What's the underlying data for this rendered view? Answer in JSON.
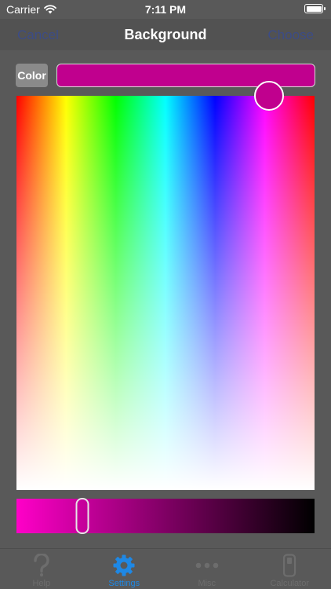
{
  "status_bar": {
    "carrier": "Carrier",
    "time": "7:11 PM"
  },
  "nav": {
    "cancel_label": "Cancel",
    "title": "Background",
    "choose_label": "Choose",
    "link_color": "#3c4c86"
  },
  "color_row": {
    "button_label": "Color",
    "selected_color": "#c0008e"
  },
  "spectrum": {
    "hue_stops": [
      "#ff0000",
      "#ffff00",
      "#00ff00",
      "#00ffff",
      "#0000ff",
      "#ff00ff",
      "#ff0000"
    ],
    "selected_hue_deg": 305,
    "selected_saturation": 1.0
  },
  "brightness": {
    "value": 0.78,
    "start_color": "#ff00c8",
    "end_color": "#000000"
  },
  "tab_bar": {
    "active_color": "#1e88e5",
    "items": [
      {
        "label": "Help",
        "icon": "question-mark-icon",
        "active": false
      },
      {
        "label": "Settings",
        "icon": "gear-icon",
        "active": true
      },
      {
        "label": "Misc",
        "icon": "ellipsis-icon",
        "active": false
      },
      {
        "label": "Calculator",
        "icon": "calculator-icon",
        "active": false
      }
    ]
  }
}
